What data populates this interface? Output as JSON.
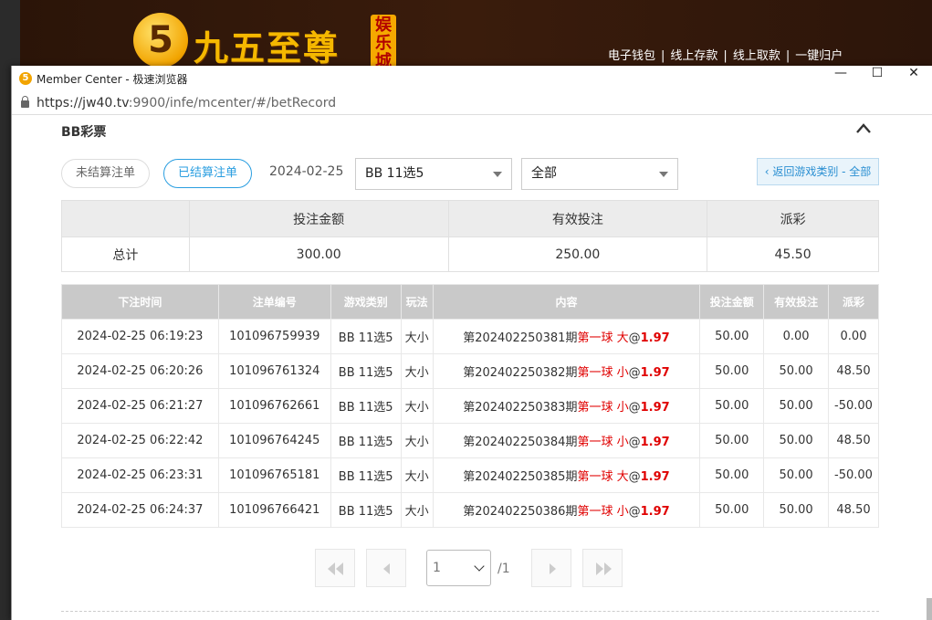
{
  "site": {
    "logo_glyph": "5",
    "logo_text": "九五至尊",
    "logo_badge": "娱乐城",
    "links": [
      "电子钱包",
      "线上存款",
      "线上取款",
      "一键归户"
    ]
  },
  "browser": {
    "title": "Member Center - 极速浏览器",
    "url_host": "https://jw40.tv",
    "url_rest": ":9900/infe/mcenter/#/betRecord"
  },
  "section": {
    "title": "BB彩票"
  },
  "filters": {
    "unsettled_label": "未结算注单",
    "settled_label": "已结算注单",
    "date": "2024-02-25",
    "game_select": "BB 11选5",
    "type_select": "全部",
    "back_label": "‹ 返回游戏类别 - 全部"
  },
  "summary": {
    "headers": [
      "",
      "投注金额",
      "有效投注",
      "派彩"
    ],
    "row": [
      "总计",
      "300.00",
      "250.00",
      "45.50"
    ]
  },
  "records": {
    "headers": [
      "下注时间",
      "注单编号",
      "游戏类别",
      "玩法",
      "内容",
      "投注金额",
      "有效投注",
      "派彩"
    ],
    "rows": [
      {
        "time": "2024-02-25 06:19:23",
        "id": "101096759939",
        "game": "BB 11选5",
        "play": "大小",
        "period": "第202402250381期",
        "ball": "第一球",
        "pick": "大",
        "at": "@",
        "odds": "1.97",
        "bet": "50.00",
        "valid": "0.00",
        "payout": "0.00",
        "neg": false
      },
      {
        "time": "2024-02-25 06:20:26",
        "id": "101096761324",
        "game": "BB 11选5",
        "play": "大小",
        "period": "第202402250382期",
        "ball": "第一球",
        "pick": "小",
        "at": "@",
        "odds": "1.97",
        "bet": "50.00",
        "valid": "50.00",
        "payout": "48.50",
        "neg": false
      },
      {
        "time": "2024-02-25 06:21:27",
        "id": "101096762661",
        "game": "BB 11选5",
        "play": "大小",
        "period": "第202402250383期",
        "ball": "第一球",
        "pick": "小",
        "at": "@",
        "odds": "1.97",
        "bet": "50.00",
        "valid": "50.00",
        "payout": "-50.00",
        "neg": true
      },
      {
        "time": "2024-02-25 06:22:42",
        "id": "101096764245",
        "game": "BB 11选5",
        "play": "大小",
        "period": "第202402250384期",
        "ball": "第一球",
        "pick": "小",
        "at": "@",
        "odds": "1.97",
        "bet": "50.00",
        "valid": "50.00",
        "payout": "48.50",
        "neg": false
      },
      {
        "time": "2024-02-25 06:23:31",
        "id": "101096765181",
        "game": "BB 11选5",
        "play": "大小",
        "period": "第202402250385期",
        "ball": "第一球",
        "pick": "大",
        "at": "@",
        "odds": "1.97",
        "bet": "50.00",
        "valid": "50.00",
        "payout": "-50.00",
        "neg": true
      },
      {
        "time": "2024-02-25 06:24:37",
        "id": "101096766421",
        "game": "BB 11选5",
        "play": "大小",
        "period": "第202402250386期",
        "ball": "第一球",
        "pick": "小",
        "at": "@",
        "odds": "1.97",
        "bet": "50.00",
        "valid": "50.00",
        "payout": "48.50",
        "neg": false
      }
    ]
  },
  "pagination": {
    "current": "1",
    "total": "/1"
  }
}
